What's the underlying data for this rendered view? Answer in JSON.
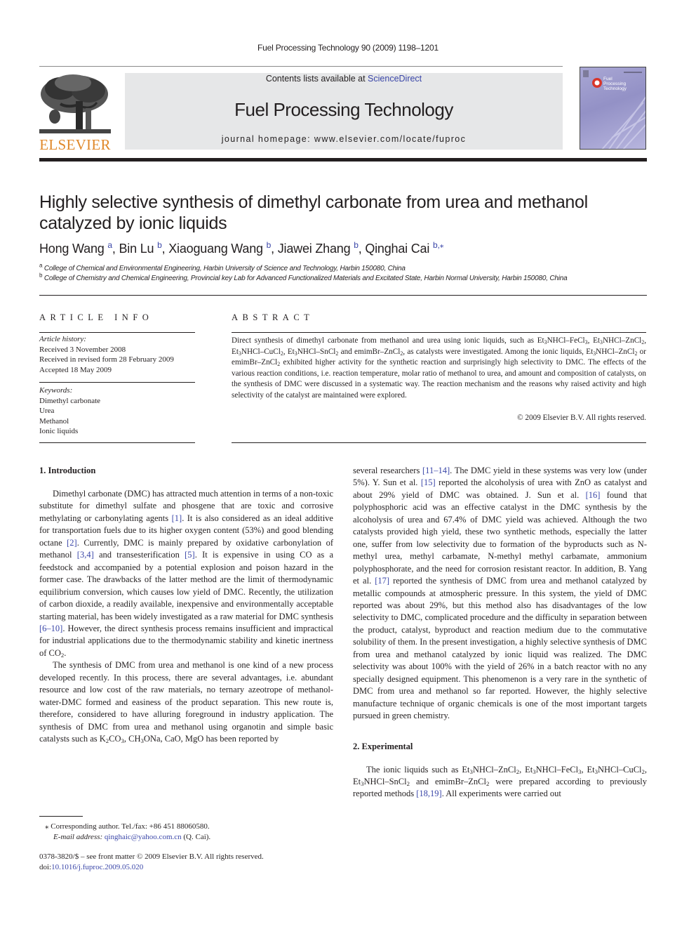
{
  "running_head": "Fuel Processing Technology 90 (2009) 1198–1201",
  "masthead": {
    "contents_prefix": "Contents lists available at ",
    "contents_link": "ScienceDirect",
    "journal_title": "Fuel Processing Technology",
    "homepage": "journal homepage: www.elsevier.com/locate/fuproc",
    "publisher_logo_text": "ELSEVIER",
    "cover_title": "Fuel Processing Technology",
    "colors": {
      "publisher_orange": "#e0882a",
      "link_blue": "#3a46a8",
      "masthead_gray": "#e6e7e8",
      "cover_purple": "#9391c6"
    }
  },
  "article": {
    "title": "Highly selective synthesis of dimethyl carbonate from urea and methanol catalyzed by ionic liquids",
    "authors": [
      {
        "name": "Hong Wang",
        "sup": "a"
      },
      {
        "name": "Bin Lu",
        "sup": "b"
      },
      {
        "name": "Xiaoguang Wang",
        "sup": "b"
      },
      {
        "name": "Jiawei Zhang",
        "sup": "b"
      },
      {
        "name": "Qinghai Cai",
        "sup": "b,⁎"
      }
    ],
    "affiliations": [
      {
        "key": "a",
        "text": "College of Chemical and Environmental Engineering, Harbin University of Science and Technology, Harbin 150080, China"
      },
      {
        "key": "b",
        "text": "College of Chemistry and Chemical Engineering, Provincial key Lab for Advanced Functionalized Materials and Excitated State, Harbin Normal University, Harbin 150080, China"
      }
    ]
  },
  "article_info": {
    "heading": "ARTICLE INFO",
    "history_label": "Article history:",
    "history": [
      "Received 3 November 2008",
      "Received in revised form 28 February 2009",
      "Accepted 18 May 2009"
    ],
    "keywords_label": "Keywords:",
    "keywords": [
      "Dimethyl carbonate",
      "Urea",
      "Methanol",
      "Ionic liquids"
    ]
  },
  "abstract": {
    "heading": "ABSTRACT",
    "text_html": "Direct synthesis of dimethyl carbonate from methanol and urea using ionic liquids, such as Et<sub>3</sub>NHCl–FeCl<sub>3</sub>, Et<sub>3</sub>NHCl–ZnCl<sub>2</sub>, Et<sub>3</sub>NHCl–CuCl<sub>2</sub>, Et<sub>3</sub>NHCl–SnCl<sub>2</sub> and emimBr–ZnCl<sub>2</sub>, as catalysts were investigated. Among the ionic liquids, Et<sub>3</sub>NHCl–ZnCl<sub>2</sub> or emimBr–ZnCl<sub>2</sub> exhibited higher activity for the synthetic reaction and surprisingly high selectivity to DMC. The effects of the various reaction conditions, i.e. reaction temperature, molar ratio of methanol to urea, and amount and composition of catalysts, on the synthesis of DMC were discussed in a systematic way. The reaction mechanism and the reasons why raised activity and high selectivity of the catalyst are maintained were explored.",
    "copyright": "© 2009 Elsevier B.V. All rights reserved."
  },
  "body": {
    "sections": [
      {
        "heading": "1. Introduction"
      },
      {
        "heading": "2. Experimental"
      }
    ],
    "left_paragraphs_html": [
      "Dimethyl carbonate (DMC) has attracted much attention in terms of a non-toxic substitute for dimethyl sulfate and phosgene that are toxic and corrosive methylating or carbonylating agents <span class=\"link\">[1]</span>. It is also considered as an ideal additive for transportation fuels due to its higher oxygen content (53%) and good blending octane <span class=\"link\">[2]</span>. Currently, DMC is mainly prepared by oxidative carbonylation of methanol <span class=\"link\">[3,4]</span> and transesterification <span class=\"link\">[5]</span>. It is expensive in using CO as a feedstock and accompanied by a potential explosion and poison hazard in the former case. The drawbacks of the latter method are the limit of thermodynamic equilibrium conversion, which causes low yield of DMC. Recently, the utilization of carbon dioxide, a readily available, inexpensive and environmentally acceptable starting material, has been widely investigated as a raw material for DMC synthesis <span class=\"link\">[6–10]</span>. However, the direct synthesis process remains insufficient and impractical for industrial applications due to the thermodynamic stability and kinetic inertness of CO<sub>2</sub>.",
      "The synthesis of DMC from urea and methanol is one kind of a new process developed recently. In this process, there are several advantages, i.e. abundant resource and low cost of the raw materials, no ternary azeotrope of methanol-water-DMC formed and easiness of the product separation. This new route is, therefore, considered to have alluring foreground in industry application. The synthesis of DMC from urea and methanol using organotin and simple basic catalysts such as K<sub>2</sub>CO<sub>3</sub>, CH<sub>3</sub>ONa, CaO, MgO has been reported by"
    ],
    "right_paragraphs_html": [
      "several researchers <span class=\"link\">[11–14]</span>. The DMC yield in these systems was very low (under 5%). Y. Sun et al. <span class=\"link\">[15]</span> reported the alcoholysis of urea with ZnO as catalyst and about 29% yield of DMC was obtained. J. Sun et al. <span class=\"link\">[16]</span> found that polyphosphoric acid was an effective catalyst in the DMC synthesis by the alcoholysis of urea and 67.4% of DMC yield was achieved. Although the two catalysts provided high yield, these two synthetic methods, especially the latter one, suffer from low selectivity due to formation of the byproducts such as N-methyl urea, methyl carbamate, N-methyl methyl carbamate, ammonium polyphosphorate, and the need for corrosion resistant reactor. In addition, B. Yang et al. <span class=\"link\">[17]</span> reported the synthesis of DMC from urea and methanol catalyzed by metallic compounds at atmospheric pressure. In this system, the yield of DMC reported was about 29%, but this method also has disadvantages of the low selectivity to DMC, complicated procedure and the difficulty in separation between the product, catalyst, byproduct and reaction medium due to the commutative solubility of them. In the present investigation, a highly selective synthesis of DMC from urea and methanol catalyzed by ionic liquid was realized. The DMC selectivity was about 100% with the yield of 26% in a batch reactor with no any specially designed equipment. This phenomenon is a very rare in the synthetic of DMC from urea and methanol so far reported. However, the highly selective manufacture technique of organic chemicals is one of the most important targets pursued in green chemistry.",
      "The ionic liquids such as Et<sub>3</sub>NHCl–ZnCl<sub>2</sub>, Et<sub>3</sub>NHCl–FeCl<sub>3</sub>, Et<sub>3</sub>NHCl–CuCl<sub>2</sub>, Et<sub>3</sub>NHCl–SnCl<sub>2</sub> and emimBr–ZnCl<sub>2</sub> were prepared according to previously reported methods <span class=\"link\">[18,19]</span>. All experiments were carried out"
    ]
  },
  "footnotes": {
    "corresponding": "⁎  Corresponding author. Tel./fax: +86 451 88060580.",
    "email_label": "E-mail address: ",
    "email": "qinghaic@yahoo.com.cn",
    "email_suffix": " (Q. Cai).",
    "issn_line": "0378-3820/$ – see front matter © 2009 Elsevier B.V. All rights reserved.",
    "doi_label": "doi:",
    "doi": "10.1016/j.fuproc.2009.05.020"
  }
}
